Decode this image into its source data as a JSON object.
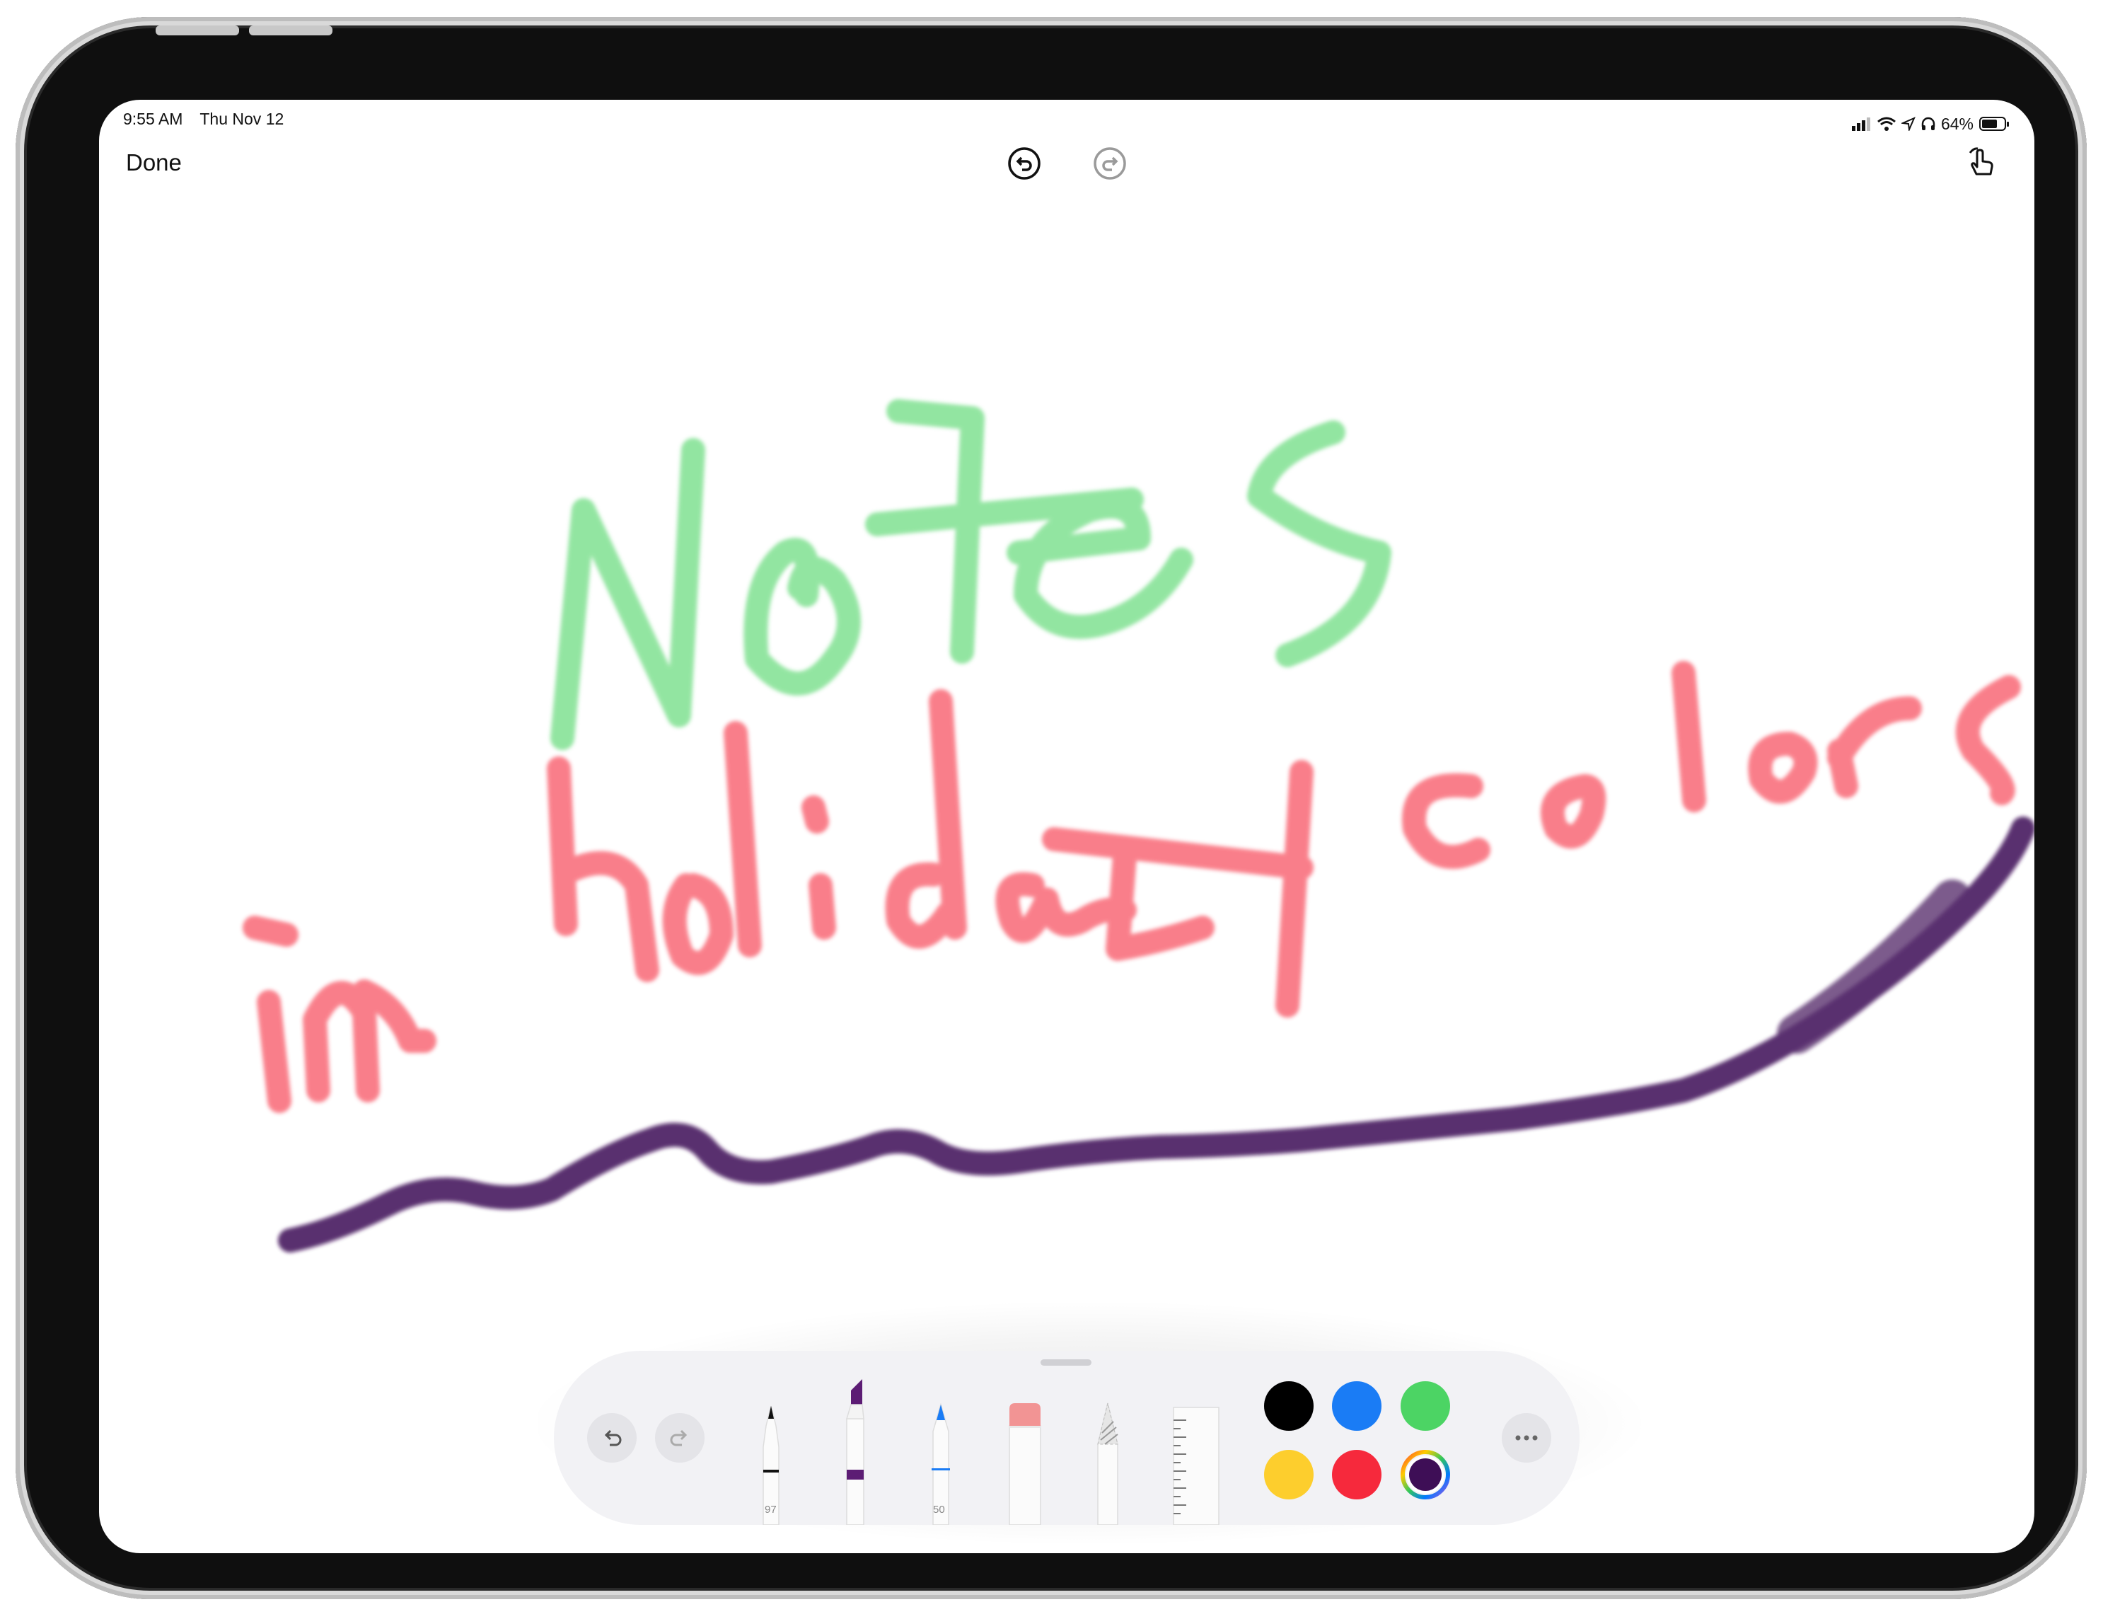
{
  "status": {
    "time": "9:55 AM",
    "date": "Thu Nov 12",
    "battery": "64%",
    "icons": [
      "cellular-signal-icon",
      "wifi-icon",
      "location-icon",
      "headphones-icon",
      "battery-icon"
    ]
  },
  "navbar": {
    "done_label": "Done",
    "undo_icon": "undo-circle-icon",
    "redo_icon": "redo-circle-icon",
    "touch_icon": "finger-draw-icon"
  },
  "toolbar": {
    "tools": [
      {
        "name": "pen",
        "value": "97"
      },
      {
        "name": "marker"
      },
      {
        "name": "pencil",
        "value": "50"
      },
      {
        "name": "eraser"
      },
      {
        "name": "lasso"
      },
      {
        "name": "ruler"
      }
    ],
    "colors": [
      "#000000",
      "#1a7cf5",
      "#4cd464",
      "#fdce2d",
      "#f6293c",
      "#3e0e56"
    ],
    "selected_color": "#3e0e56",
    "more_icon": "ellipsis-icon"
  },
  "drawing": {
    "strokes": [
      {
        "color": "#4cd464"
      },
      {
        "color": "#f6293c"
      },
      {
        "color": "#3e0e56"
      }
    ]
  }
}
